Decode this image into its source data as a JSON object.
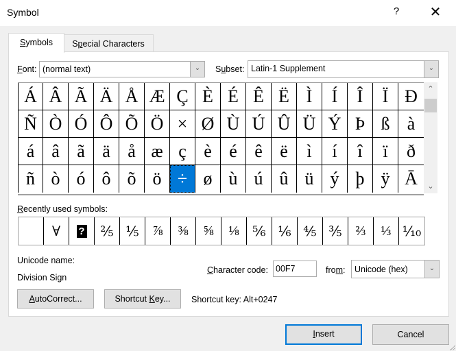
{
  "window": {
    "title": "Symbol",
    "help_label": "?",
    "close_label": "✕"
  },
  "tabs": [
    {
      "label_pre": "",
      "label_key": "S",
      "label_post": "ymbols",
      "active": true
    },
    {
      "label_pre": "S",
      "label_key": "p",
      "label_post": "ecial Characters",
      "active": false
    }
  ],
  "font": {
    "label_key": "F",
    "label_post": "ont:",
    "value": "(normal text)"
  },
  "subset": {
    "label_pre": "S",
    "label_key": "u",
    "label_post": "bset:",
    "value": "Latin-1 Supplement"
  },
  "symbol_grid": {
    "rows": [
      [
        "Á",
        "Â",
        "Ã",
        "Ä",
        "Å",
        "Æ",
        "Ç",
        "È",
        "É",
        "Ê",
        "Ë",
        "Ì",
        "Í",
        "Î",
        "Ï",
        "Ð"
      ],
      [
        "Ñ",
        "Ò",
        "Ó",
        "Ô",
        "Õ",
        "Ö",
        "×",
        "Ø",
        "Ù",
        "Ú",
        "Û",
        "Ü",
        "Ý",
        "Þ",
        "ß",
        "à"
      ],
      [
        "á",
        "â",
        "ã",
        "ä",
        "å",
        "æ",
        "ç",
        "è",
        "é",
        "ê",
        "ë",
        "ì",
        "í",
        "î",
        "ï",
        "ð"
      ],
      [
        "ñ",
        "ò",
        "ó",
        "ô",
        "õ",
        "ö",
        "÷",
        "ø",
        "ù",
        "ú",
        "û",
        "ü",
        "ý",
        "þ",
        "ÿ",
        "Ā"
      ]
    ],
    "selected": "÷"
  },
  "scrollbar": {
    "up": "^",
    "down": "v"
  },
  "recent": {
    "label_key": "R",
    "label_post": "ecently used symbols:",
    "symbols": [
      "",
      "∀",
      "?",
      "⅖",
      "⅕",
      "⅞",
      "⅜",
      "⅝",
      "⅛",
      "⅚",
      "⅙",
      "⅘",
      "⅗",
      "⅔",
      "⅓",
      "⅒"
    ]
  },
  "unicode_name": {
    "label": "Unicode name:",
    "value": "Division Sign"
  },
  "char_code": {
    "label_key": "C",
    "label_post": "haracter code:",
    "value": "00F7"
  },
  "from": {
    "label_pre": "fro",
    "label_key": "m",
    "label_post": ":",
    "value": "Unicode (hex)"
  },
  "buttons": {
    "autocorrect": {
      "key": "A",
      "post": "utoCorrect..."
    },
    "shortcut": {
      "pre": "Shortcut ",
      "key": "K",
      "post": "ey..."
    },
    "insert": {
      "key": "I",
      "post": "nsert"
    },
    "cancel": "Cancel"
  },
  "shortcut_key_text": "Shortcut key: Alt+0247"
}
